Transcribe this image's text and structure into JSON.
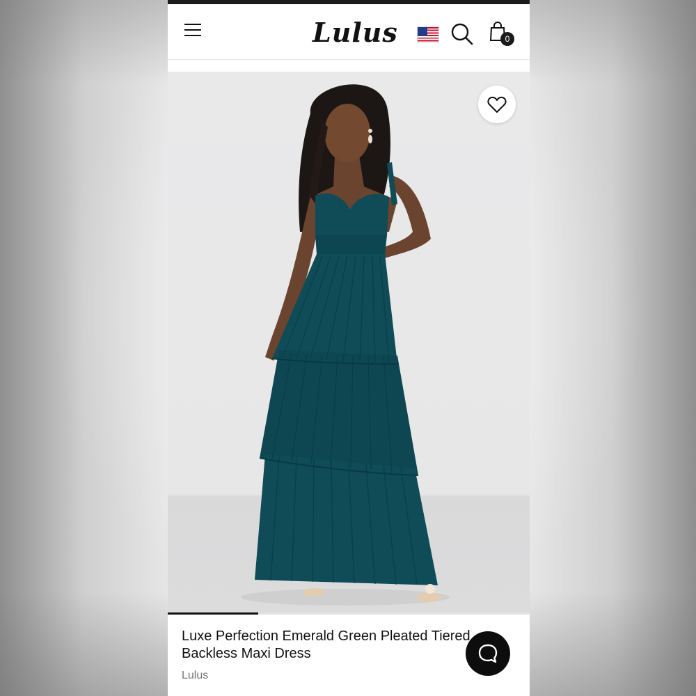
{
  "header": {
    "menu_icon": "hamburger-menu-icon",
    "logo_text": "Lulus",
    "region_flag": "us-flag-icon",
    "search_icon": "search-icon",
    "bag_icon": "shopping-bag-icon",
    "bag_count": "0"
  },
  "product": {
    "image_subject": "emerald-green-tiered-maxi-dress-photo",
    "favorite_icon": "heart-icon",
    "gallery_progress": 0.25,
    "title": "Luxe Perfection Emerald Green Pleated Tiered Backless Maxi Dress",
    "brand": "Lulus"
  },
  "chat": {
    "icon": "chat-bubble-icon"
  },
  "colors": {
    "dress": "#0f4c57",
    "background_studio": "#e8e8e9",
    "text_primary": "#111111",
    "text_secondary": "#777777"
  }
}
